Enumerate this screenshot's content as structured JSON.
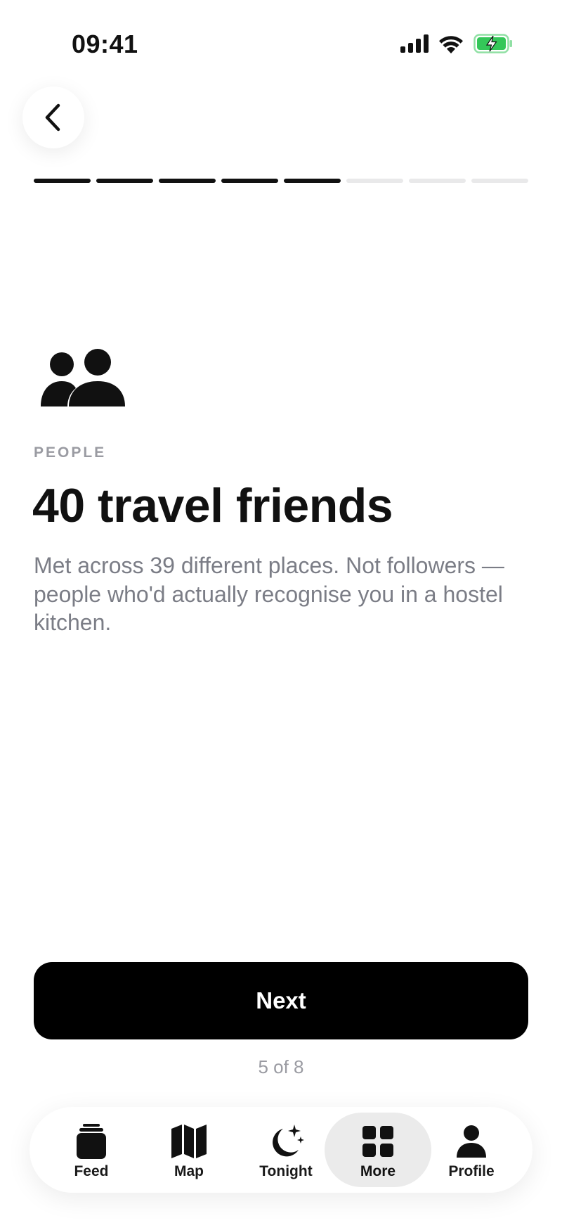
{
  "status_bar": {
    "time": "09:41",
    "signal_icon": "cellular-signal-icon",
    "wifi_icon": "wifi-icon",
    "battery_icon": "battery-charging-icon",
    "battery_color": "#34c759"
  },
  "header": {
    "back_icon": "chevron-left-icon"
  },
  "progress": {
    "current": 5,
    "total": 8
  },
  "card": {
    "icon": "people-icon",
    "eyebrow": "PEOPLE",
    "title": "40 travel friends",
    "body": "Met across 39 different places. Not followers — people who'd actually recognise you in a hostel kitchen."
  },
  "next_button": {
    "label": "Next"
  },
  "step_label": "5 of 8",
  "tabbar": {
    "items": [
      {
        "label": "Feed",
        "icon": "feed-stack-icon",
        "active": false
      },
      {
        "label": "Map",
        "icon": "map-icon",
        "active": false
      },
      {
        "label": "Tonight",
        "icon": "moon-stars-icon",
        "active": false
      },
      {
        "label": "More",
        "icon": "grid-icon",
        "active": true
      },
      {
        "label": "Profile",
        "icon": "person-icon",
        "active": false
      }
    ]
  },
  "colors": {
    "primary": "#000000",
    "muted_text": "#7b7d86",
    "eyebrow_text": "#9a9ba2",
    "progress_inactive": "#e9e9ea",
    "tab_active_bg": "#ebebeb"
  }
}
